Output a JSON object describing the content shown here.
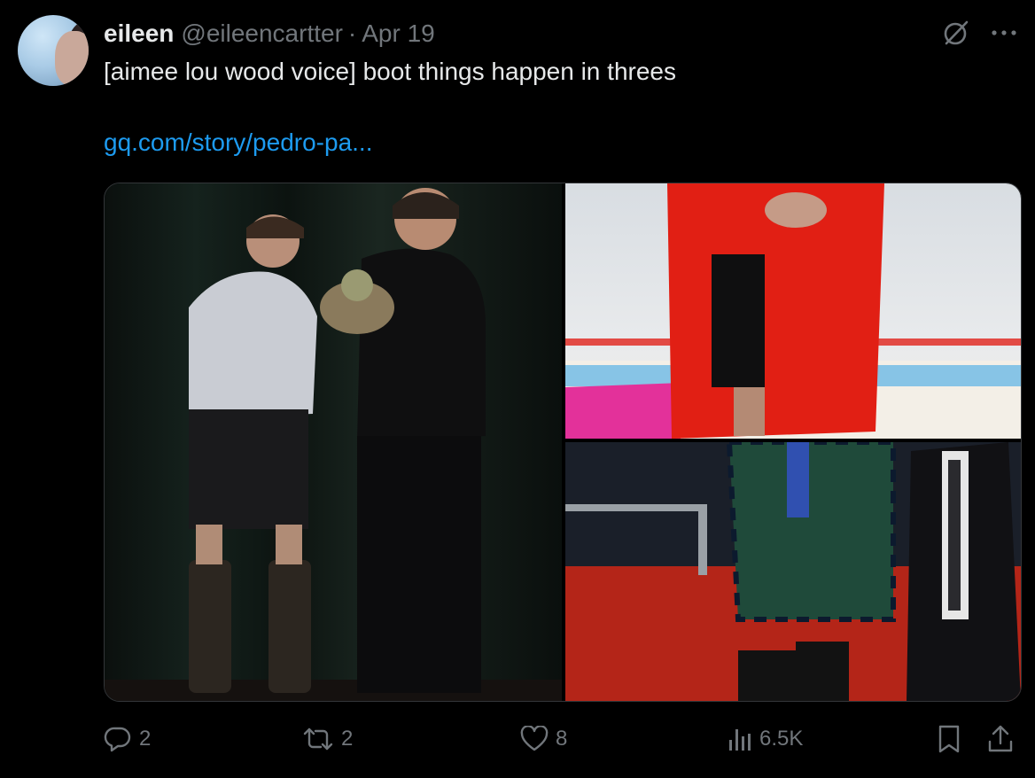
{
  "tweet": {
    "display_name": "eileen",
    "handle": "@eileencartter",
    "separator": "·",
    "date": "Apr 19",
    "text": "[aimee lou wood voice] boot things happen in threes",
    "link": "gq.com/story/pedro-pa..."
  },
  "header_icons": [
    "grok-icon",
    "more-icon"
  ],
  "media": [
    {
      "name": "photo-stage-boots"
    },
    {
      "name": "photo-red-coat"
    },
    {
      "name": "photo-plaid-blazer"
    }
  ],
  "actions": {
    "reply_count": "2",
    "retweet_count": "2",
    "like_count": "8",
    "views_count": "6.5K"
  },
  "colors": {
    "background": "#000000",
    "text": "#e7e9ea",
    "muted": "#71767b",
    "link": "#1d9bf0"
  }
}
